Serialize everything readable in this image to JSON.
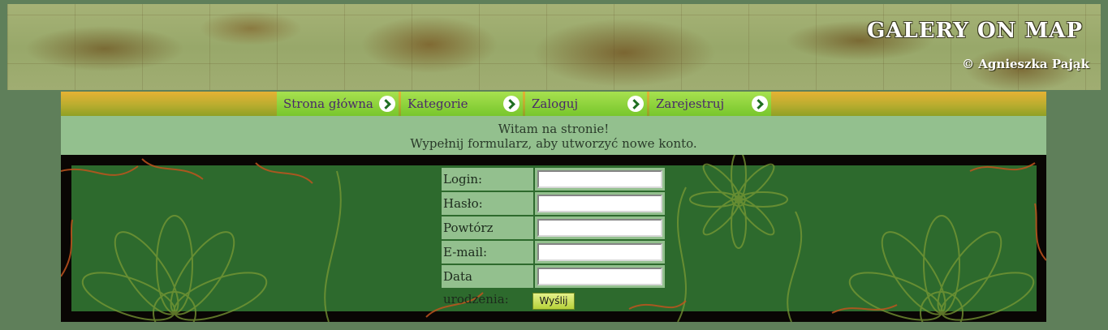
{
  "header": {
    "site_title": "GALERY ON MAP",
    "copyright": "© Agnieszka Pająk"
  },
  "nav": {
    "items": [
      {
        "label": "Strona główna"
      },
      {
        "label": "Kategorie"
      },
      {
        "label": "Zaloguj"
      },
      {
        "label": "Zarejestruj"
      }
    ]
  },
  "welcome": {
    "line1": "Witam na stronie!",
    "line2": "Wypełnij formularz, aby utworzyć nowe konto."
  },
  "form": {
    "fields": [
      {
        "label": "Login:",
        "value": ""
      },
      {
        "label": "Hasło:",
        "value": ""
      },
      {
        "label": "Powtórz hasło:",
        "value": ""
      },
      {
        "label": "E-mail:",
        "value": ""
      },
      {
        "label": "Data urodzenia:",
        "value": ""
      }
    ],
    "submit_label": "Wyślij"
  },
  "colors": {
    "page_bg": "#5f7f5a",
    "nav_green": "#78c62c",
    "panel_green": "#93c08e",
    "floral_bg": "#2d6a2d"
  }
}
